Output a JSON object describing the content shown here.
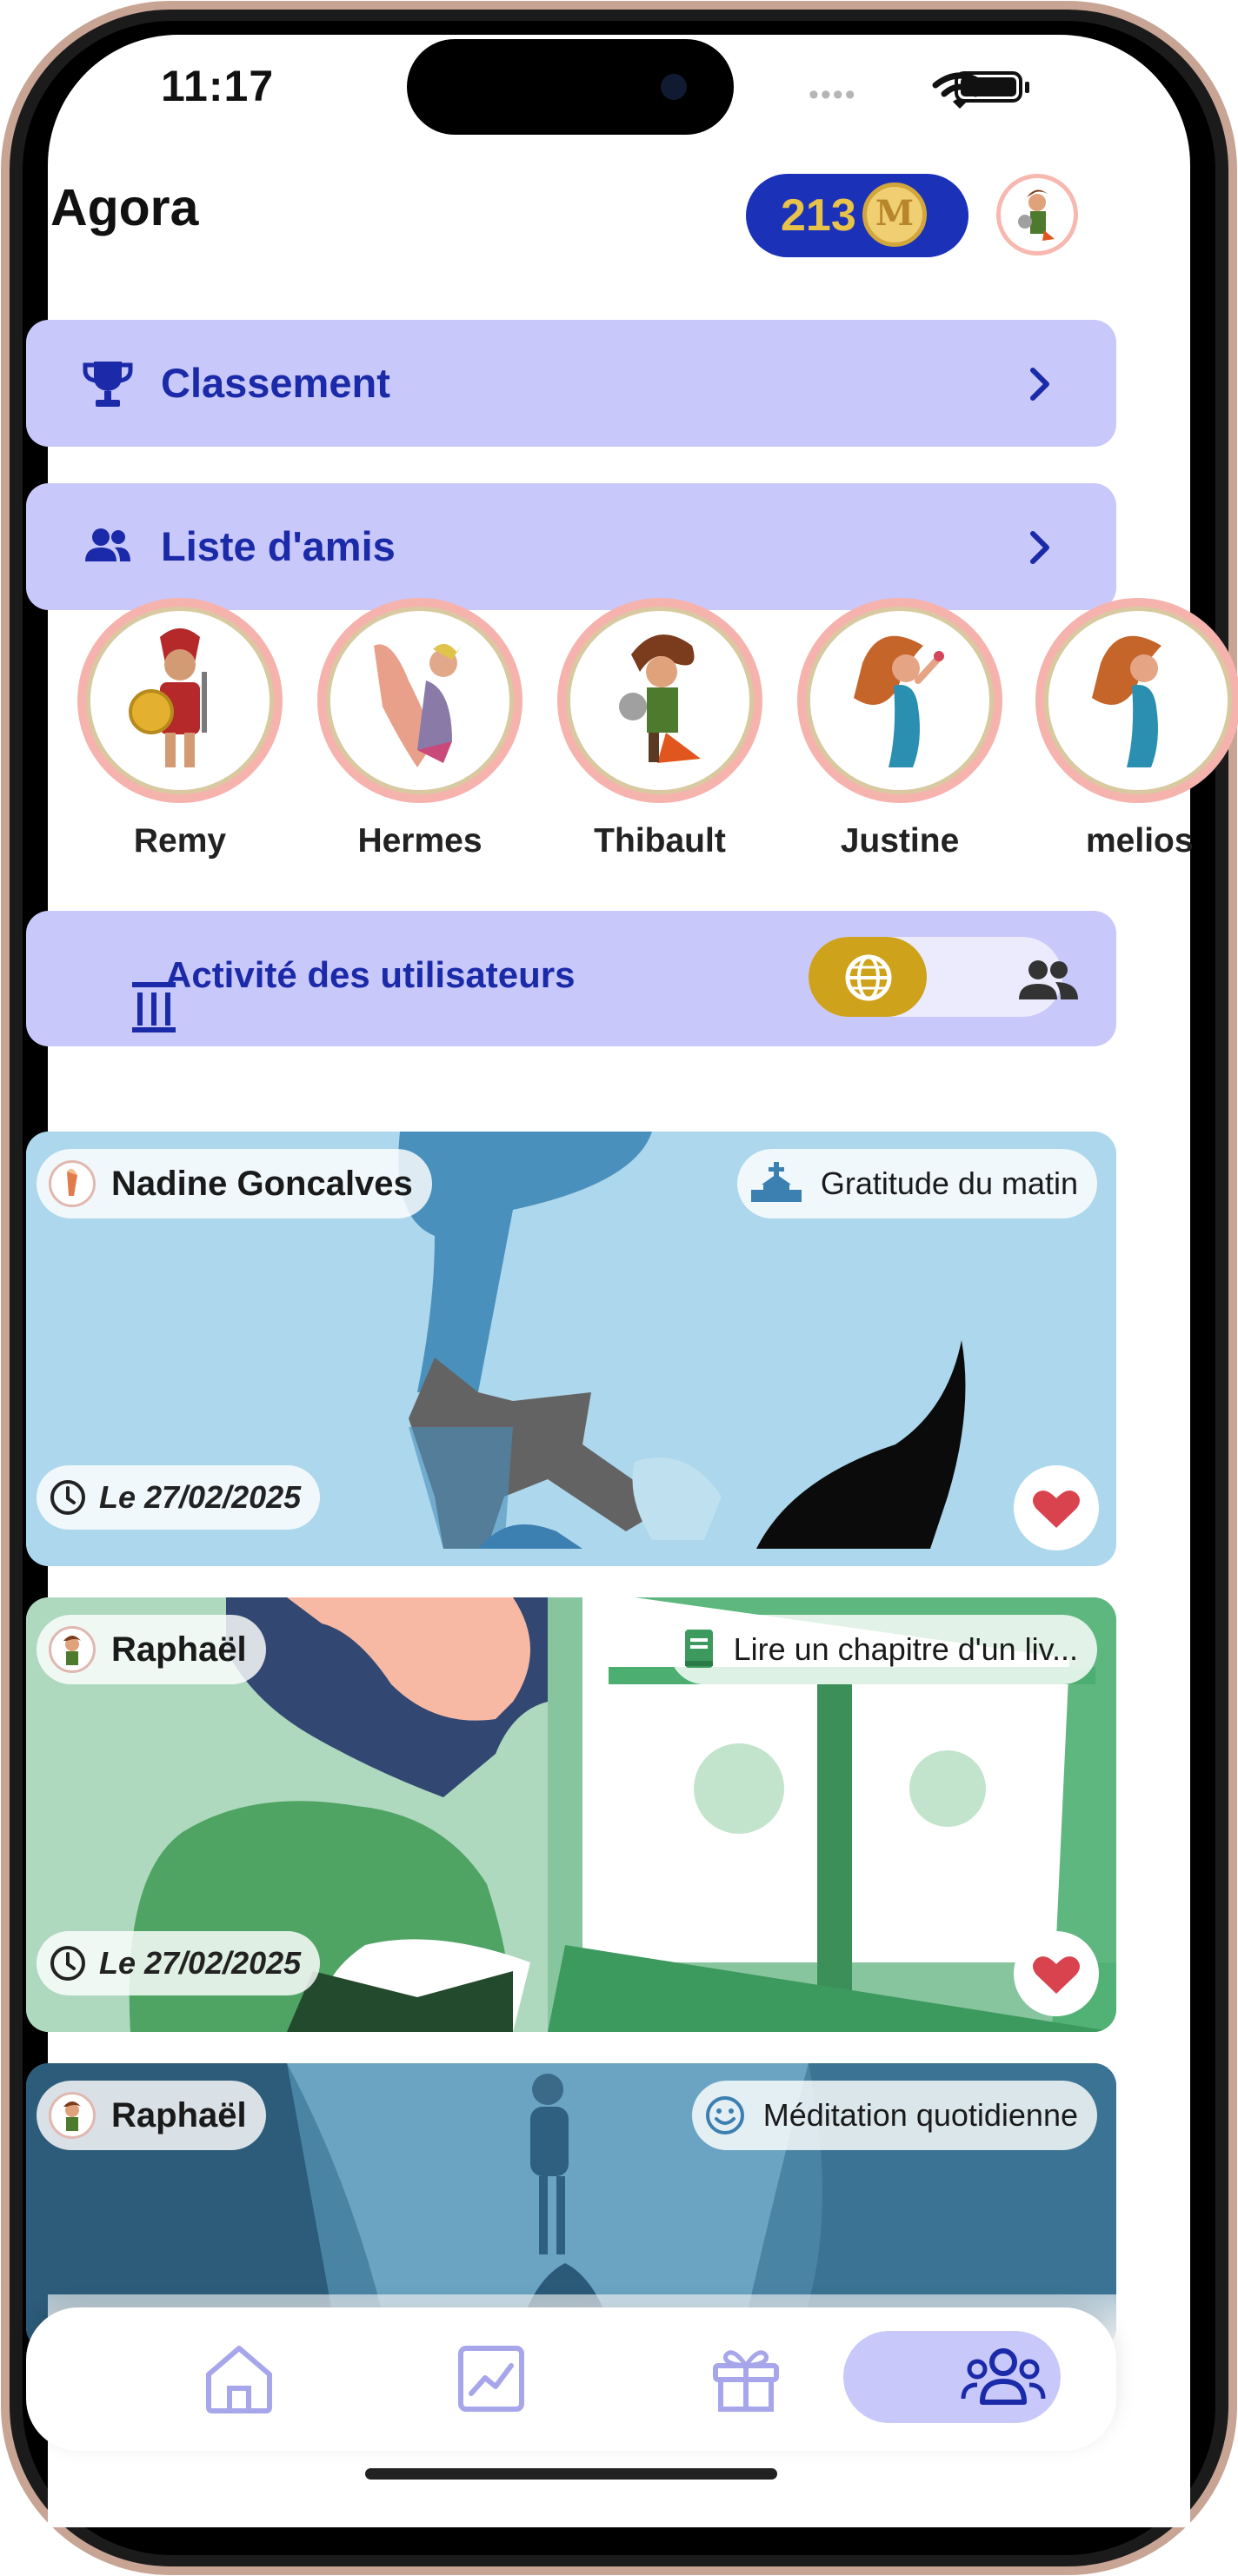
{
  "status_bar": {
    "time": "11:17",
    "signal": "••••"
  },
  "header": {
    "title": "Agora",
    "coins": "213",
    "coin_symbol": "M"
  },
  "menu": [
    {
      "label": "Classement",
      "icon": "trophy-icon"
    },
    {
      "label": "Liste d'amis",
      "icon": "friends-icon"
    }
  ],
  "friends": [
    {
      "name": "Remy"
    },
    {
      "name": "Hermes"
    },
    {
      "name": "Thibault"
    },
    {
      "name": "Justine"
    },
    {
      "name": "melios"
    }
  ],
  "activity": {
    "title": "Activité des utilisateurs",
    "toggle": {
      "selected": "global",
      "options": [
        "globe-icon",
        "friends-icon"
      ]
    }
  },
  "feed": [
    {
      "user": "Nadine Goncalves",
      "habit": "Gratitude du matin",
      "habit_icon": "temple-icon",
      "date": "Le 27/02/2025",
      "liked": true
    },
    {
      "user": "Raphaël",
      "habit": "Lire un chapitre d'un liv...",
      "habit_icon": "book-icon",
      "date": "Le 27/02/2025",
      "liked": true
    },
    {
      "user": "Raphaël",
      "habit": "Méditation quotidienne",
      "habit_icon": "smile-icon"
    }
  ],
  "tabs": [
    {
      "name": "home-icon",
      "active": false
    },
    {
      "name": "chart-icon",
      "active": false
    },
    {
      "name": "gift-icon",
      "active": false
    },
    {
      "name": "community-icon",
      "active": true
    }
  ],
  "colors": {
    "accent": "#1a2aa8",
    "card": "#c9c8fb",
    "coin_badge": "#1a31b8",
    "toggle_active": "#cfa21c",
    "heart": "#d9434e"
  }
}
